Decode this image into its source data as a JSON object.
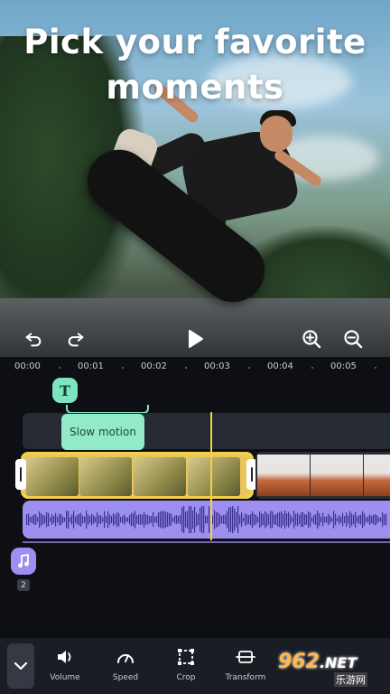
{
  "headline": {
    "line1": "Pick your favorite",
    "line2": "moments"
  },
  "timeline": {
    "ticks": [
      "00:00",
      "00:01",
      "00:02",
      "00:03",
      "00:04",
      "00:05"
    ],
    "text_badge": "T",
    "effect_label": "Slow motion",
    "music_count": "2"
  },
  "toolbar": {
    "items": [
      {
        "label": "Volume",
        "icon": "volume-icon"
      },
      {
        "label": "Speed",
        "icon": "speed-icon"
      },
      {
        "label": "Crop",
        "icon": "crop-icon"
      },
      {
        "label": "Transform",
        "icon": "transform-icon"
      }
    ]
  },
  "watermark": {
    "logo": "962",
    "tld": ".NET",
    "sub": "乐游网"
  },
  "colors": {
    "accent_yellow": "#f2cf4c",
    "effect_green": "#93eac9",
    "audio_purple": "#9d8ff0",
    "background": "#0d0f14"
  }
}
